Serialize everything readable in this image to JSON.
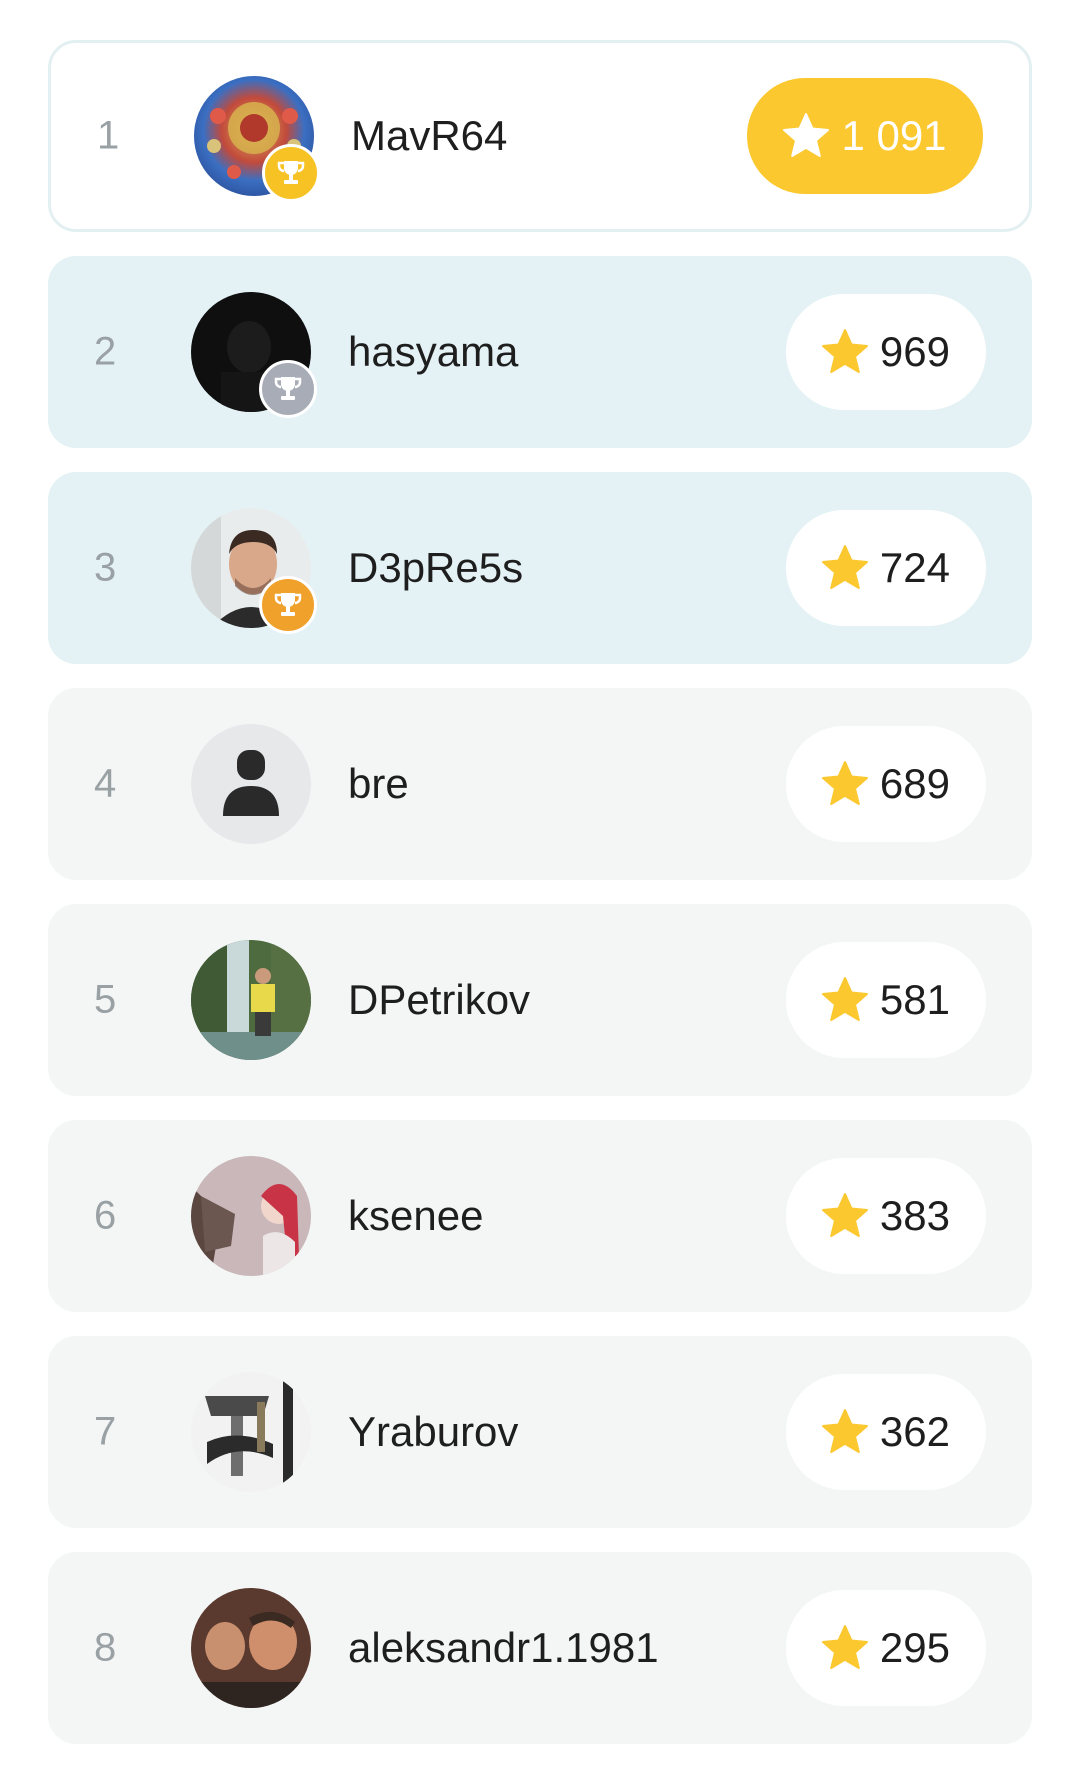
{
  "colors": {
    "gold": "#f6c224",
    "silver": "#a7acb6",
    "bronze": "#f0a12b",
    "star": "#fcc82f",
    "highlight_row": "#e4f2f6",
    "row": "#f4f6f6"
  },
  "leaderboard": [
    {
      "rank": "1",
      "username": "MavR64",
      "score": "1 091",
      "trophy": "gold",
      "avatar": "emblem-photo"
    },
    {
      "rank": "2",
      "username": "hasyama",
      "score": "969",
      "trophy": "silver",
      "avatar": "dark-photo"
    },
    {
      "rank": "3",
      "username": "D3pRe5s",
      "score": "724",
      "trophy": "bronze",
      "avatar": "portrait-photo"
    },
    {
      "rank": "4",
      "username": "bre",
      "score": "689",
      "trophy": null,
      "avatar": "default-user-icon"
    },
    {
      "rank": "5",
      "username": "DPetrikov",
      "score": "581",
      "trophy": null,
      "avatar": "waterfall-photo"
    },
    {
      "rank": "6",
      "username": "ksenee",
      "score": "383",
      "trophy": null,
      "avatar": "anime-wolf-girl-photo"
    },
    {
      "rank": "7",
      "username": "Yraburov",
      "score": "362",
      "trophy": null,
      "avatar": "axe-photo"
    },
    {
      "rank": "8",
      "username": "aleksandr1.1981",
      "score": "295",
      "trophy": null,
      "avatar": "family-photo"
    }
  ]
}
